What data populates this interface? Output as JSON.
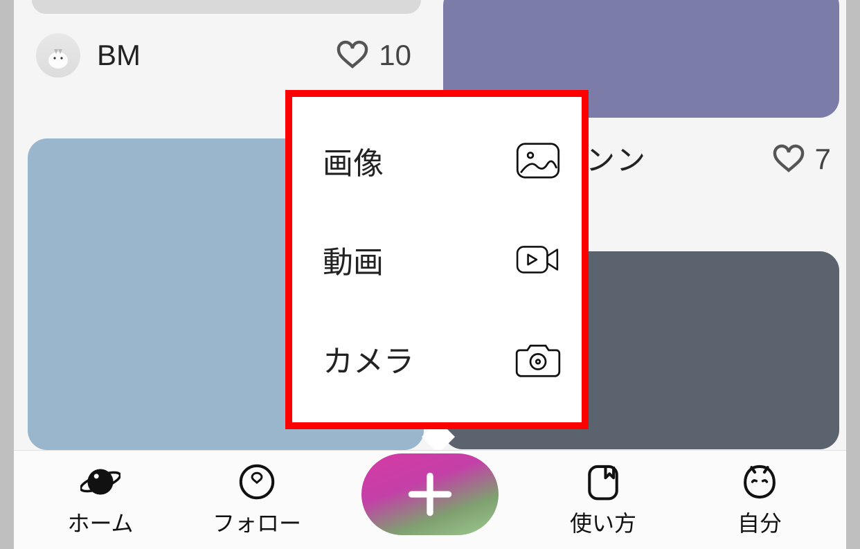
{
  "feed": {
    "card1": {
      "username": "BM",
      "likes": "10"
    },
    "card2": {
      "username_fragment": "ンン",
      "likes": "7"
    }
  },
  "compose_menu": {
    "items": [
      {
        "label": "画像",
        "icon": "image-icon"
      },
      {
        "label": "動画",
        "icon": "video-icon"
      },
      {
        "label": "カメラ",
        "icon": "camera-icon"
      }
    ]
  },
  "navbar": {
    "home": {
      "label": "ホーム"
    },
    "follow": {
      "label": "フォロー"
    },
    "howto": {
      "label": "使い方"
    },
    "me": {
      "label": "自分"
    }
  }
}
